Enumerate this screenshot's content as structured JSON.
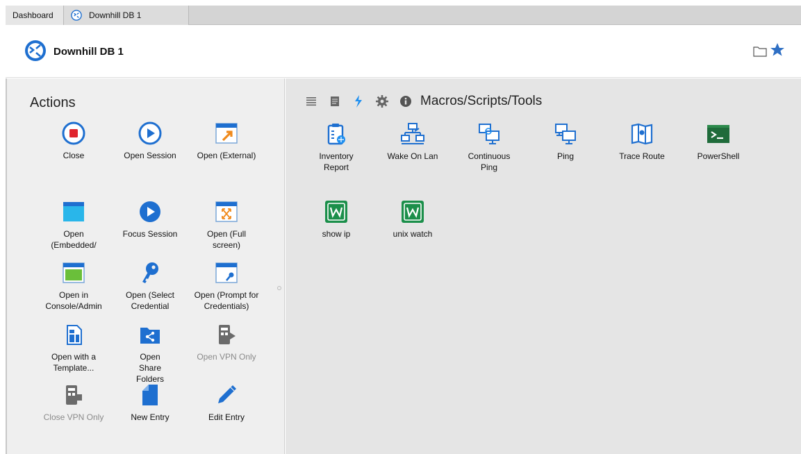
{
  "tabs": [
    {
      "label": "Dashboard"
    },
    {
      "label": "Downhill DB 1",
      "icon": "remote-desktop-icon"
    }
  ],
  "header": {
    "title": "Downhill DB 1",
    "icon": "remote-desktop-icon"
  },
  "actions": {
    "title": "Actions",
    "items": [
      {
        "label": "Close",
        "icon": "stop-icon"
      },
      {
        "label": "Open Session",
        "icon": "play-outline-icon"
      },
      {
        "label": "Open (External)",
        "icon": "external-window-icon"
      },
      {
        "label": "Open (Embedded/",
        "icon": "embedded-window-icon"
      },
      {
        "label": "Focus Session",
        "icon": "play-filled-icon"
      },
      {
        "label": "Open (Full screen)",
        "icon": "fullscreen-window-icon"
      },
      {
        "label": "Open in Console/Admin",
        "icon": "console-window-icon"
      },
      {
        "label": "Open (Select Credential",
        "icon": "key-icon"
      },
      {
        "label": "Open (Prompt for Credentials)",
        "icon": "prompt-credentials-icon"
      },
      {
        "label": "Open with a Template...",
        "icon": "template-icon"
      },
      {
        "label": "Open Share Folders",
        "icon": "share-folder-icon"
      },
      {
        "label": "Open VPN Only",
        "icon": "vpn-icon"
      },
      {
        "label": "Close VPN Only",
        "icon": "vpn-icon"
      },
      {
        "label": "New Entry",
        "icon": "new-document-icon"
      },
      {
        "label": "Edit Entry",
        "icon": "pencil-icon"
      }
    ]
  },
  "tools": {
    "title": "Macros/Scripts/Tools",
    "toolbar": [
      "list-icon",
      "notes-icon",
      "macros-icon",
      "gear-icon",
      "info-icon"
    ],
    "items": [
      {
        "label": "Inventory Report",
        "icon": "inventory-report-icon"
      },
      {
        "label": "Wake On Lan",
        "icon": "network-icon"
      },
      {
        "label": "Continuous Ping",
        "icon": "continuous-ping-icon"
      },
      {
        "label": "Ping",
        "icon": "ping-icon"
      },
      {
        "label": "Trace Route",
        "icon": "trace-route-icon"
      },
      {
        "label": "PowerShell",
        "icon": "powershell-icon"
      },
      {
        "label": "show ip",
        "icon": "script-w-icon"
      },
      {
        "label": "unix watch",
        "icon": "script-w-icon"
      }
    ]
  },
  "colors": {
    "accent": "#1e6fd0",
    "stop": "#e0242c",
    "powershell": "#1f6b3a",
    "script_green": "#1b8f4a"
  }
}
